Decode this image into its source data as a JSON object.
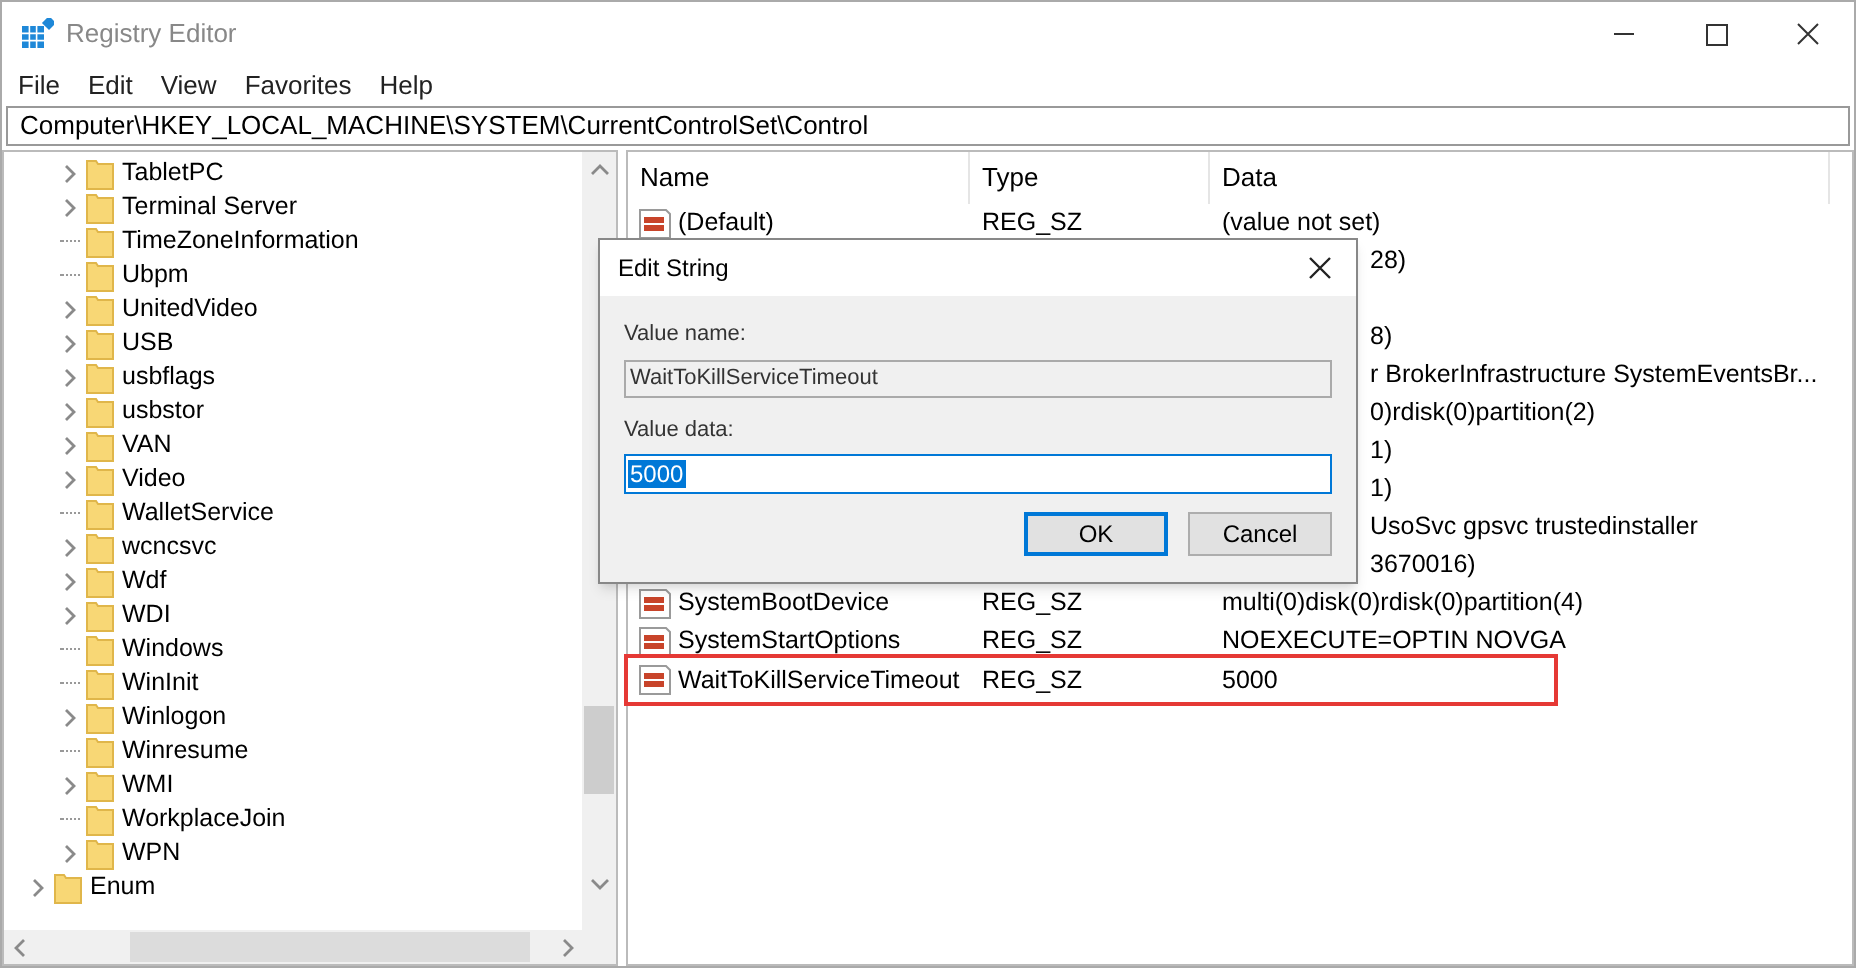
{
  "window": {
    "title": "Registry Editor"
  },
  "menu": [
    "File",
    "Edit",
    "View",
    "Favorites",
    "Help"
  ],
  "address": "Computer\\HKEY_LOCAL_MACHINE\\SYSTEM\\CurrentControlSet\\Control",
  "tree": {
    "children": [
      {
        "label": "TabletPC",
        "expandable": true
      },
      {
        "label": "Terminal Server",
        "expandable": true
      },
      {
        "label": "TimeZoneInformation",
        "expandable": false
      },
      {
        "label": "Ubpm",
        "expandable": false
      },
      {
        "label": "UnitedVideo",
        "expandable": true
      },
      {
        "label": "USB",
        "expandable": true
      },
      {
        "label": "usbflags",
        "expandable": true
      },
      {
        "label": "usbstor",
        "expandable": true
      },
      {
        "label": "VAN",
        "expandable": true
      },
      {
        "label": "Video",
        "expandable": true
      },
      {
        "label": "WalletService",
        "expandable": false
      },
      {
        "label": "wcncsvc",
        "expandable": true
      },
      {
        "label": "Wdf",
        "expandable": true
      },
      {
        "label": "WDI",
        "expandable": true
      },
      {
        "label": "Windows",
        "expandable": false
      },
      {
        "label": "WinInit",
        "expandable": false
      },
      {
        "label": "Winlogon",
        "expandable": true
      },
      {
        "label": "Winresume",
        "expandable": false
      },
      {
        "label": "WMI",
        "expandable": true
      },
      {
        "label": "WorkplaceJoin",
        "expandable": false
      },
      {
        "label": "WPN",
        "expandable": true
      }
    ],
    "siblings": [
      {
        "label": "Enum",
        "expandable": true
      }
    ]
  },
  "table": {
    "columns": [
      "Name",
      "Type",
      "Data"
    ],
    "rows": [
      {
        "name": "(Default)",
        "type": "REG_SZ",
        "data": "(value not set)",
        "highlighted": false
      },
      {
        "data": "28)",
        "highlighted": false
      },
      {},
      {
        "data": "8)",
        "highlighted": false
      },
      {
        "data": "r BrokerInfrastructure SystemEventsBr...",
        "highlighted": false
      },
      {
        "data": "0)rdisk(0)partition(2)",
        "highlighted": false
      },
      {
        "data": "1)",
        "highlighted": false
      },
      {
        "data": "1)",
        "highlighted": false
      },
      {
        "data": "UsoSvc gpsvc trustedinstaller",
        "highlighted": false
      },
      {
        "data": "3670016)",
        "highlighted": false
      },
      {
        "name": "SystemBootDevice",
        "type": "REG_SZ",
        "data": "multi(0)disk(0)rdisk(0)partition(4)",
        "highlighted": false
      },
      {
        "name": "SystemStartOptions",
        "type": "REG_SZ",
        "data": "NOEXECUTE=OPTIN  NOVGA",
        "highlighted": false
      },
      {
        "name": "WaitToKillServiceTimeout",
        "type": "REG_SZ",
        "data": "5000",
        "highlighted": true
      }
    ]
  },
  "dialog": {
    "title": "Edit String",
    "name_label": "Value name:",
    "name_value": "WaitToKillServiceTimeout",
    "data_label": "Value data:",
    "data_value": "5000",
    "buttons": [
      "OK",
      "Cancel"
    ]
  }
}
